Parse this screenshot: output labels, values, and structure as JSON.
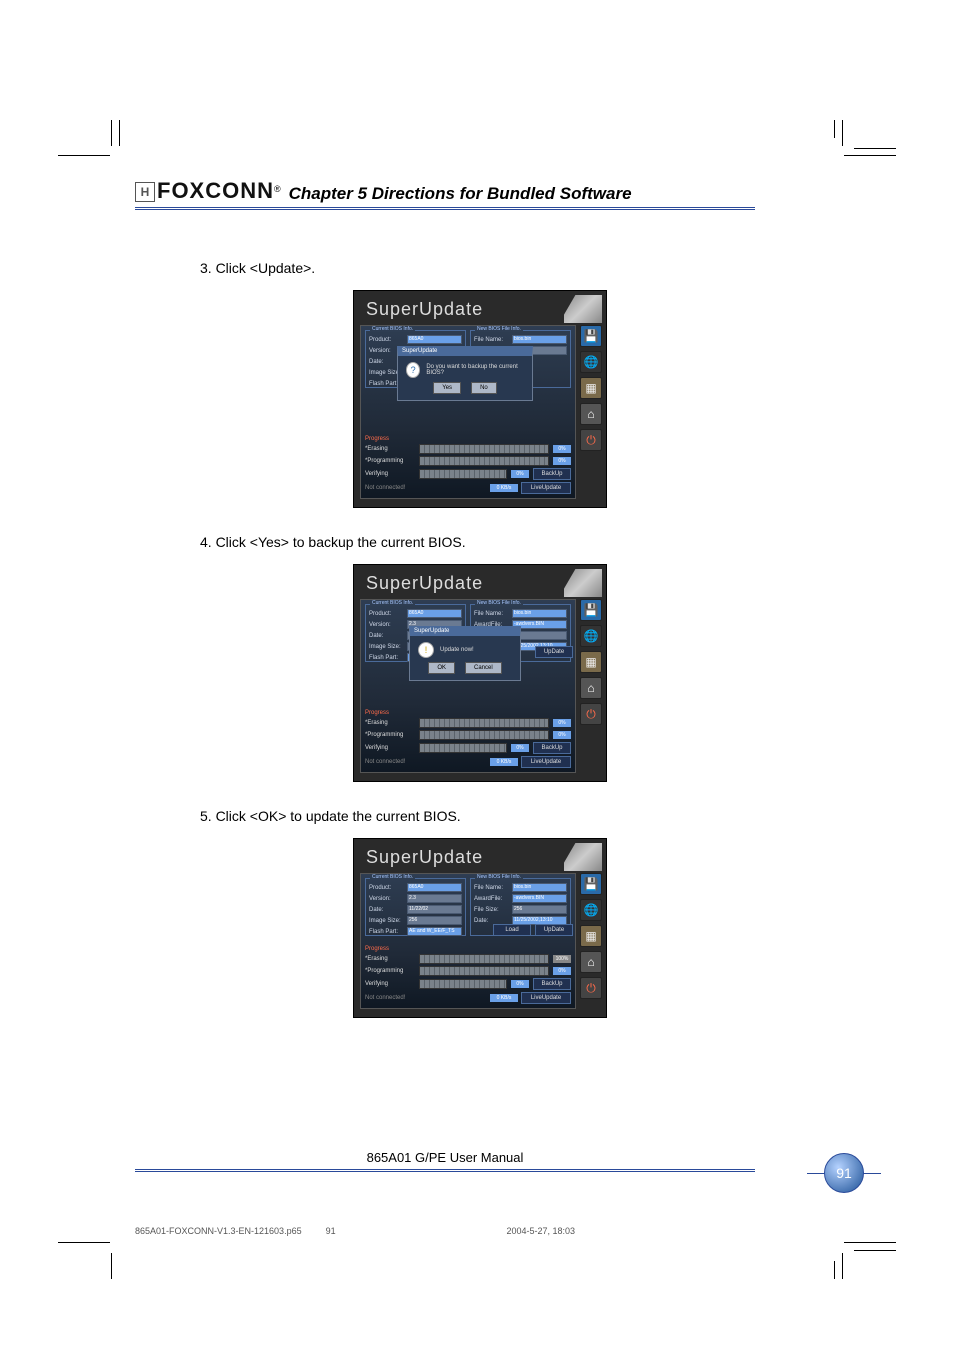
{
  "brand": "FOXCONN",
  "register_mark": "®",
  "chapter_title": "Chapter 5  Directions for Bundled Software",
  "steps": {
    "s3": "3. Click <Update>.",
    "s4": "4. Click <Yes> to backup the current BIOS.",
    "s5": "5. Click <OK> to update the current BIOS."
  },
  "app_title": "SuperUpdate",
  "fieldset": {
    "current": "Current BIOS Info.",
    "newfile": "New BIOS File Info."
  },
  "labels": {
    "product": "Product:",
    "version": "Version:",
    "date": "Date:",
    "image_size": "Image Size:",
    "flash_part": "Flash Part:",
    "file_name": "File Name:",
    "awardfile": "AwardFile:",
    "file_size": "File Size:"
  },
  "vals": {
    "product": "865A0",
    "version": "2.3",
    "date": "11/22/02",
    "size": "256",
    "flash_part": "AE and W_EE/F_TS",
    "file_new": "bios.bin",
    "file_award": "-awdvers.BIN",
    "file_size_val": "256",
    "file_date": "11/25/2002,13:10"
  },
  "dialog": {
    "title": "SuperUpdate",
    "icon_question": "?",
    "icon_excl": "!",
    "msg_backup": "Do you want to backup the current BIOS?",
    "msg_update": "Update now!",
    "yes": "Yes",
    "no": "No",
    "ok": "OK",
    "cancel": "Cancel"
  },
  "progress": {
    "header": "Progress",
    "erasing_row": "*Erasing",
    "programming": "*Programming",
    "verifying": "Verifying",
    "pct": "0%",
    "backup_btn": "BackUp",
    "load_btn": "Load",
    "update_btn": "UpDate",
    "liveupdate": "LiveUpdate"
  },
  "status": {
    "not_connected": "Not connected!",
    "rate": "0 KB/s"
  },
  "icons": {
    "save": "💾",
    "web": "🌐",
    "chip": "▦",
    "gear": "⌂",
    "power": "⏻"
  },
  "footer": "865A01 G/PE User Manual",
  "page_num": "91",
  "meta": {
    "file": "865A01-FOXCONN-V1.3-EN-121603.p65",
    "page": "91",
    "datetime": "2004-5-27, 18:03"
  }
}
